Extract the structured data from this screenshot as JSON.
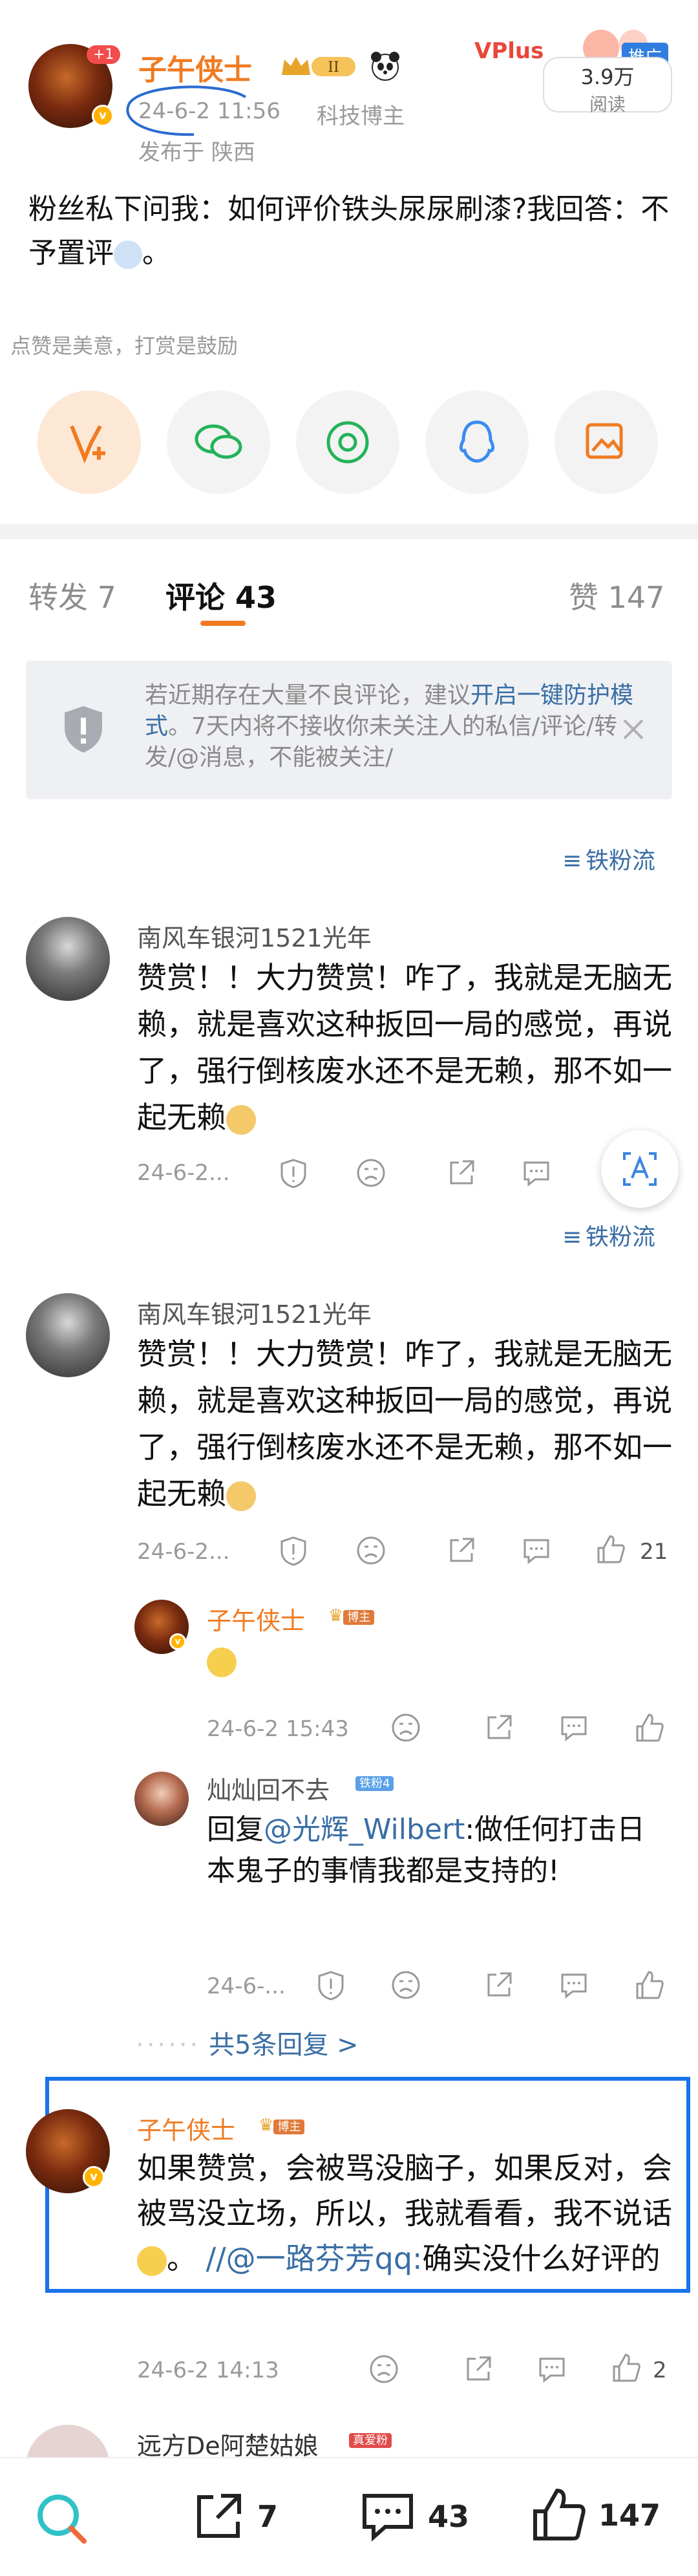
{
  "post": {
    "author": "子午侠士",
    "level_badge": "II",
    "notif_count": "+1",
    "date": "24-6-2 11:56",
    "category": "科技博主",
    "location": "发布于 陕西",
    "text": "粉丝私下问我：如何评价铁头尿尿刷漆?我回答：不予置评",
    "reads": "3.9万",
    "reads_label": "阅读",
    "ad_label": "推广",
    "vplus": "VPlus",
    "encourage": "点赞是美意，打赏是鼓励"
  },
  "tabs": {
    "forward": "转发 7",
    "comments": "评论 43",
    "likes": "赞 147"
  },
  "notice": {
    "text_a": "若近期存在大量不良评论，建议",
    "link": "开启一键防护模式",
    "text_b": "。7天内将不接收你未关注人的私信/评论/转发/@消息，不能被关注/"
  },
  "sort_label": "铁粉流",
  "comments": [
    {
      "name": "南风车银河1521光年",
      "text": "赞赏！！大力赞赏！咋了，我就是无脑无赖，就是喜欢这种扳回一局的感觉，再说了，强行倒核废水还不是无赖，那不如一起无赖",
      "date": "24-6-2...",
      "likes": ""
    },
    {
      "name": "南风车银河1521光年",
      "text": "赞赏！！大力赞赏！咋了，我就是无脑无赖，就是喜欢这种扳回一局的感觉，再说了，强行倒核废水还不是无赖，那不如一起无赖",
      "date": "24-6-2...",
      "likes": "21"
    }
  ],
  "replies": [
    {
      "name": "子午侠士",
      "tag": "博主",
      "text": "",
      "date": "24-6-2 15:43"
    },
    {
      "name": "灿灿回不去",
      "tag": "铁粉4",
      "text_prefix": "回复",
      "mention": "@光辉_Wilbert",
      "text": ":做任何打击日本鬼子的事情我都是支持的!",
      "date": "24-6-..."
    }
  ],
  "more_replies": "共5条回复 >",
  "highlight_comment": {
    "name": "子午侠士",
    "tag": "博主",
    "text": "如果赞赏，会被骂没脑子，如果反对，会被骂没立场，所以，我就看看，我不说话",
    "mention": "//@一路芬芳qq:",
    "text_tail": "确实没什么好评的",
    "date": "24-6-2 14:13",
    "likes": "2"
  },
  "last_comment": {
    "name": "远方De阿楚姑娘",
    "tag": "真爱粉"
  },
  "bottom_bar": {
    "forward": "7",
    "comments": "43",
    "likes": "147"
  },
  "colors": {
    "accent": "#f07b22",
    "link": "#3a6ea5",
    "select": "#1a73e8"
  }
}
